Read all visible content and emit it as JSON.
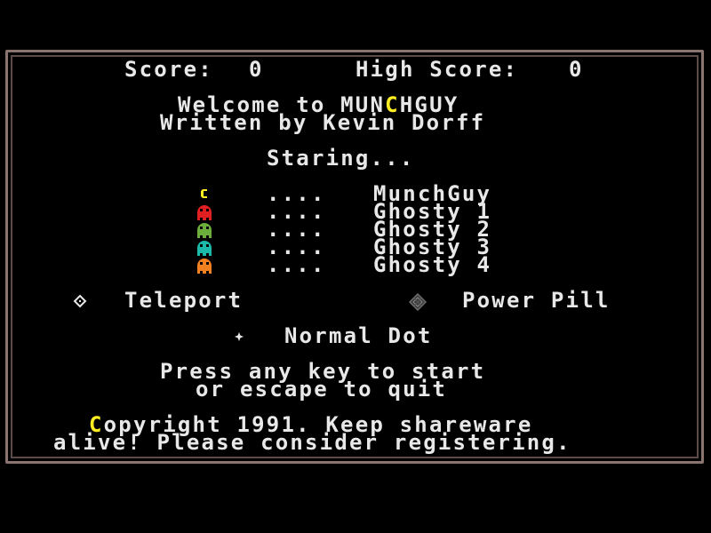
{
  "hud": {
    "score_label": "Score:",
    "score_value": "0",
    "high_score_label": "High Score:",
    "high_score_value": "0"
  },
  "title": {
    "welcome_prefix": "Welcome to ",
    "game_name_part1": "MUN",
    "game_name_c": "C",
    "game_name_part2": "HGUY",
    "author": "Written by Kevin Dorff"
  },
  "cast": {
    "heading": "Staring...",
    "dots": "....",
    "members": [
      {
        "name": "MunchGuy",
        "icon": "munchguy-icon",
        "color": "#ffee22"
      },
      {
        "name": "Ghosty 1",
        "icon": "ghost-icon",
        "color": "#e02020"
      },
      {
        "name": "Ghosty 2",
        "icon": "ghost-icon",
        "color": "#6cae3c"
      },
      {
        "name": "Ghosty 3",
        "icon": "ghost-icon",
        "color": "#1cb8a8"
      },
      {
        "name": "Ghosty 4",
        "icon": "ghost-icon",
        "color": "#f08020"
      }
    ]
  },
  "legend": {
    "teleport": "Teleport",
    "power_pill": "Power Pill",
    "normal_dot": "Normal Dot"
  },
  "prompt": {
    "line1": "Press any key to start",
    "line2": "or escape to quit"
  },
  "footer": {
    "c": "C",
    "line1_rest": "opyright 1991. Keep shareware",
    "line2": "alive! Please consider registering."
  },
  "colors": {
    "text": "#e8e8e8",
    "accent": "#ffee22",
    "frame": "#8a7470",
    "background": "#000000"
  }
}
